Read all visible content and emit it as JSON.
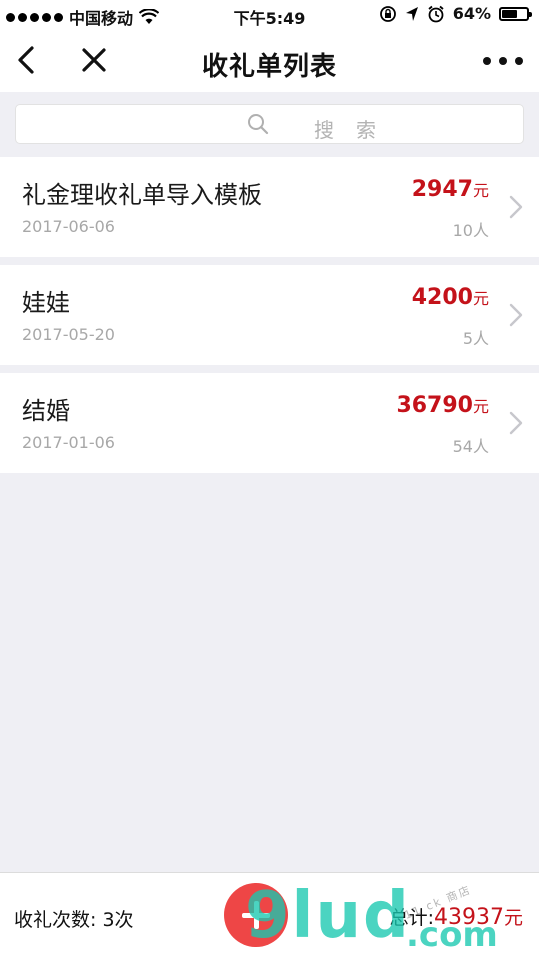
{
  "status_bar": {
    "carrier": "中国移动",
    "time": "下午5:49",
    "battery_percent_text": "64%",
    "battery_level": 0.64,
    "icons": [
      "signal-dots",
      "wifi-icon",
      "lock-rotation-icon",
      "location-arrow-icon",
      "alarm-icon",
      "battery-icon"
    ]
  },
  "nav": {
    "title": "收礼单列表",
    "icons": [
      "back-arrow-icon",
      "close-icon",
      "more-dots-icon"
    ]
  },
  "search": {
    "placeholder": "搜索",
    "icon": "search-icon"
  },
  "list": {
    "items": [
      {
        "name": "礼金理收礼单导入模板",
        "date": "2017-06-06",
        "amount": "2947",
        "unit": "元",
        "count": "10人"
      },
      {
        "name": "娃娃",
        "date": "2017-05-20",
        "amount": "4200",
        "unit": "元",
        "count": "5人"
      },
      {
        "name": "结婚",
        "date": "2017-01-06",
        "amount": "36790",
        "unit": "元",
        "count": "54人"
      }
    ]
  },
  "footer": {
    "count_text": "收礼次数: 3次",
    "total_label": "总计:",
    "total_amount": "43937",
    "total_unit": "元"
  },
  "watermark": {
    "text_main": "9lud",
    "text_com": ".com",
    "text_small": "11 ck 商店"
  },
  "colors": {
    "accent_red": "#c4121a",
    "add_button": "#ee4646",
    "background": "#efeff4",
    "watermark": "#18c8b0"
  }
}
